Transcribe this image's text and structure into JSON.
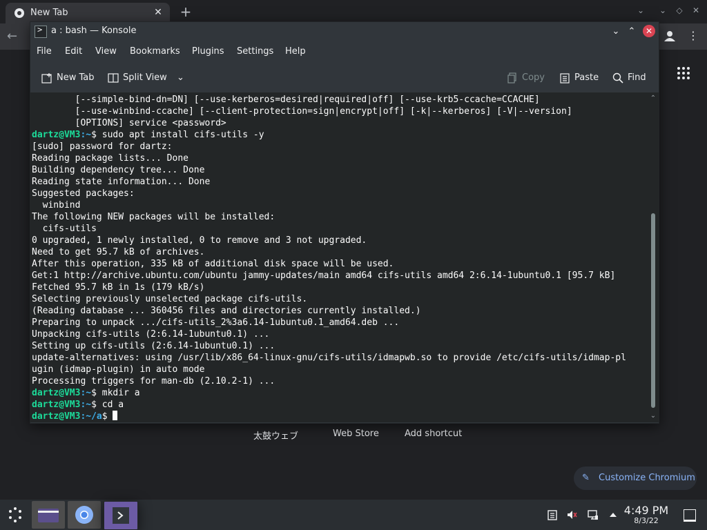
{
  "browser": {
    "tab_title": "New Tab",
    "shortcuts": [
      "太鼓ウェブ",
      "Web Store",
      "Add shortcut"
    ],
    "customize_label": "Customize Chromium"
  },
  "konsole": {
    "window_title": "a : bash — Konsole",
    "menu": [
      "File",
      "Edit",
      "View",
      "Bookmarks",
      "Plugins",
      "Settings",
      "Help"
    ],
    "toolbar": {
      "new_tab": "New Tab",
      "split_view": "Split View",
      "copy": "Copy",
      "paste": "Paste",
      "find": "Find"
    },
    "terminal_lines": [
      "        [--simple-bind-dn=DN] [--use-kerberos=desired|required|off] [--use-krb5-ccache=CCACHE]",
      "        [--use-winbind-ccache] [--client-protection=sign|encrypt|off] [-k|--kerberos] [-V|--version]",
      "        [OPTIONS] service <password>"
    ],
    "prompt": {
      "user_host": "dartz@VM3",
      "home_path": ":~",
      "a_path": ":~/a",
      "symbol": "$"
    },
    "cmd1": " sudo apt install cifs-utils -y",
    "output_lines": [
      "[sudo] password for dartz:",
      "Reading package lists... Done",
      "Building dependency tree... Done",
      "Reading state information... Done",
      "Suggested packages:",
      "  winbind",
      "The following NEW packages will be installed:",
      "  cifs-utils",
      "0 upgraded, 1 newly installed, 0 to remove and 3 not upgraded.",
      "Need to get 95.7 kB of archives.",
      "After this operation, 335 kB of additional disk space will be used.",
      "Get:1 http://archive.ubuntu.com/ubuntu jammy-updates/main amd64 cifs-utils amd64 2:6.14-1ubuntu0.1 [95.7 kB]",
      "Fetched 95.7 kB in 1s (179 kB/s)",
      "Selecting previously unselected package cifs-utils.",
      "(Reading database ... 360456 files and directories currently installed.)",
      "Preparing to unpack .../cifs-utils_2%3a6.14-1ubuntu0.1_amd64.deb ...",
      "Unpacking cifs-utils (2:6.14-1ubuntu0.1) ...",
      "Setting up cifs-utils (2:6.14-1ubuntu0.1) ...",
      "update-alternatives: using /usr/lib/x86_64-linux-gnu/cifs-utils/idmapwb.so to provide /etc/cifs-utils/idmap-pl",
      "ugin (idmap-plugin) in auto mode",
      "Processing triggers for man-db (2.10.2-1) ..."
    ],
    "cmd2": " mkdir a",
    "cmd3": " cd a"
  },
  "taskbar": {
    "time": "4:49 PM",
    "date": "8/3/22"
  },
  "colors": {
    "prompt_user": "#1cdc9a",
    "prompt_path": "#3daee9",
    "close_button": "#da4453",
    "konsole_task_active": "#6c5ba5"
  }
}
